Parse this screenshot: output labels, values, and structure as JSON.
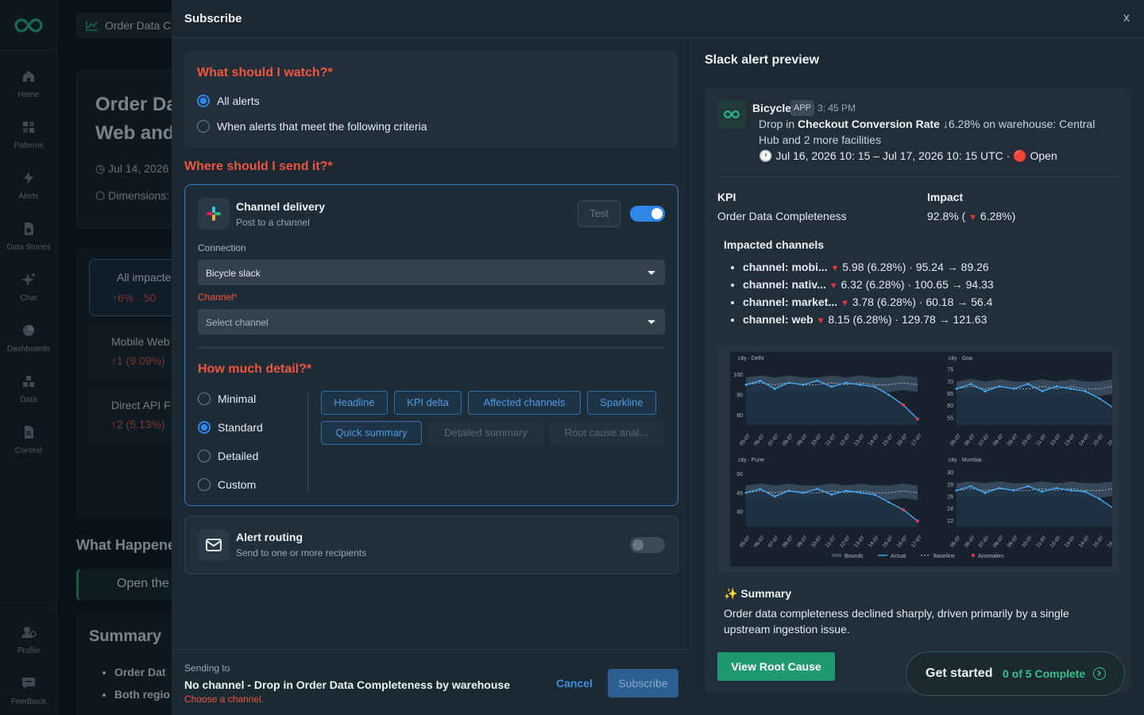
{
  "rail": {
    "items": [
      {
        "label": "Home",
        "icon": "home-icon"
      },
      {
        "label": "Patterns",
        "icon": "patterns-icon"
      },
      {
        "label": "Alerts",
        "icon": "alerts-icon"
      },
      {
        "label": "Data Stories",
        "icon": "data-stories-icon"
      },
      {
        "label": "Chat",
        "icon": "chat-icon"
      },
      {
        "label": "Dashboards",
        "icon": "dashboards-icon"
      },
      {
        "label": "Data",
        "icon": "data-icon"
      },
      {
        "label": "Context",
        "icon": "context-icon"
      }
    ],
    "bottom": [
      {
        "label": "Profile",
        "icon": "profile-icon"
      },
      {
        "label": "Feedback",
        "icon": "feedback-icon"
      }
    ]
  },
  "background": {
    "tab_label": "Order Data C",
    "title_line1": "Order Da",
    "title_line2": "Web and",
    "date": "Jul 14, 2026",
    "dimensions": "Dimensions:",
    "list": [
      {
        "label": "All impacte",
        "metric": "6% · 50"
      },
      {
        "label": "Mobile Web",
        "metric": "1 (9.09%)"
      },
      {
        "label": "Direct API F",
        "metric": "2 (5.13%)"
      }
    ],
    "what_happened": "What Happene",
    "open_label": "Open the",
    "summary_title": "Summary",
    "summary_items": [
      "Order Dat",
      "Both regio"
    ]
  },
  "modal": {
    "title": "Subscribe",
    "close": "x",
    "watch": {
      "title": "What should I watch?*",
      "options": [
        "All alerts",
        "When alerts that meet the following criteria"
      ],
      "selected": 0
    },
    "send": {
      "title": "Where should I send it?*",
      "channel_delivery": {
        "title": "Channel delivery",
        "subtitle": "Post to a channel",
        "test_label": "Test",
        "enabled": true,
        "connection_label": "Connection",
        "connection_value": "Bicycle slack",
        "channel_label": "Channel*",
        "channel_placeholder": "Select channel"
      },
      "detail": {
        "title": "How much detail?*",
        "options": [
          "Minimal",
          "Standard",
          "Detailed",
          "Custom"
        ],
        "selected": 1,
        "chips_active": [
          "Headline",
          "KPI delta",
          "Affected channels",
          "Sparkline",
          "Quick summary"
        ],
        "chips_inactive": [
          "Detailed summary",
          "Root cause anal..."
        ]
      },
      "routing": {
        "title": "Alert routing",
        "subtitle": "Send to one or more recipients",
        "enabled": false
      }
    },
    "footer": {
      "sending_to_label": "Sending to",
      "sending_to_value": "No channel - Drop in Order Data Completeness by warehouse",
      "error": "Choose a channel.",
      "cancel": "Cancel",
      "subscribe": "Subscribe"
    }
  },
  "preview": {
    "title": "Slack alert preview",
    "bot_name": "Bicycle",
    "app_badge": "APP",
    "time": "3: 45 PM",
    "msg_prefix": "Drop in ",
    "msg_kpi": "Checkout Conversion Rate",
    "msg_rest": " ↓6.28% on warehouse: Central Hub and 2 more facilities",
    "msg_line3": "🕐 Jul 16, 2026 10: 15 – Jul 17, 2026 10: 15 UTC · 🔴 Open",
    "kpi_label": "KPI",
    "kpi_value": "Order Data Completeness",
    "impact_label": "Impact",
    "impact_value_a": "92.8% ( ",
    "impact_value_b": " 6.28%)",
    "impacted_title": "Impacted channels",
    "impacted": [
      {
        "name": "channel: mobi...",
        "detail": "5.98 (6.28%) · 95.24 → 89.26"
      },
      {
        "name": "channel: nativ...",
        "detail": "6.32 (6.28%) · 100.65 → 94.33"
      },
      {
        "name": "channel: market...",
        "detail": "3.78 (6.28%) · 60.18 → 56.4"
      },
      {
        "name": "channel: web",
        "detail": "8.15 (6.28%) · 129.78 → 121.63"
      }
    ],
    "summary_title": "✨ Summary",
    "summary_text": "Order data completeness declined sharply, driven primarily by a single upstream ingestion issue.",
    "root_cause_button": "View Root Cause"
  },
  "chart_data": [
    {
      "type": "line",
      "title": "city · Delhi",
      "x": [
        "05-07",
        "06-07",
        "07-07",
        "08-07",
        "09-07",
        "10-07",
        "11-07",
        "12-07",
        "13-07",
        "14-07",
        "15-07",
        "16-07",
        "17-07"
      ],
      "yticks": [
        80,
        90,
        100
      ],
      "ylim": [
        75,
        105
      ],
      "series": [
        {
          "name": "Actual",
          "values": [
            95,
            97,
            93,
            96,
            95,
            97,
            94,
            96,
            95,
            94,
            90,
            85,
            78
          ]
        },
        {
          "name": "Baseline",
          "values": [
            95,
            96,
            95,
            96,
            95,
            95,
            96,
            95,
            96,
            95,
            95,
            96,
            95
          ]
        }
      ]
    },
    {
      "type": "line",
      "title": "city · Goa",
      "x": [
        "05-07",
        "06-07",
        "07-07",
        "08-07",
        "09-07",
        "10-07",
        "11-07",
        "12-07",
        "13-07",
        "14-07",
        "15-07",
        "16-07",
        "17-07"
      ],
      "yticks": [
        55,
        60,
        65,
        70,
        75
      ],
      "ylim": [
        52,
        77
      ],
      "series": [
        {
          "name": "Actual",
          "values": [
            67,
            69,
            66,
            68,
            67,
            69,
            66,
            68,
            67,
            66,
            63,
            59,
            54
          ]
        },
        {
          "name": "Baseline",
          "values": [
            67,
            68,
            67,
            68,
            67,
            67,
            68,
            67,
            68,
            67,
            67,
            68,
            67
          ]
        }
      ]
    },
    {
      "type": "line",
      "title": "city · Pune",
      "x": [
        "05-07",
        "06-07",
        "07-07",
        "08-07",
        "09-07",
        "10-07",
        "11-07",
        "12-07",
        "13-07",
        "14-07",
        "15-07",
        "16-07",
        "17-07"
      ],
      "yticks": [
        40,
        45,
        50
      ],
      "ylim": [
        36,
        52
      ],
      "series": [
        {
          "name": "Actual",
          "values": [
            45,
            46,
            44,
            45.5,
            45,
            46,
            44.5,
            45.5,
            45,
            44.5,
            42.5,
            40.5,
            37.5
          ]
        },
        {
          "name": "Baseline",
          "values": [
            45,
            45.5,
            45,
            45.5,
            45,
            45,
            45.5,
            45,
            45.5,
            45,
            45,
            45.5,
            45
          ]
        }
      ]
    },
    {
      "type": "line",
      "title": "city · Mumbai",
      "x": [
        "05-07",
        "06-07",
        "07-07",
        "08-07",
        "09-07",
        "10-07",
        "11-07",
        "12-07",
        "13-07",
        "14-07",
        "15-07",
        "16-07",
        "17-07"
      ],
      "yticks": [
        22,
        24,
        26,
        28,
        30
      ],
      "ylim": [
        21,
        31
      ],
      "series": [
        {
          "name": "Actual",
          "values": [
            27,
            27.7,
            26.6,
            27.4,
            27,
            27.7,
            26.8,
            27.4,
            27,
            26.8,
            25.6,
            24,
            22.2
          ]
        },
        {
          "name": "Baseline",
          "values": [
            27,
            27.3,
            27,
            27.3,
            27,
            27,
            27.3,
            27,
            27.3,
            27,
            27,
            27.3,
            27
          ]
        }
      ]
    }
  ],
  "chart_legend": [
    "Bounds",
    "Actual",
    "Baseline",
    "Anomalies"
  ],
  "get_started": {
    "label": "Get started",
    "progress": "0 of 5 Complete"
  },
  "colors": {
    "accent": "#2f87e8",
    "error": "#f0553e",
    "success": "#1f9a70",
    "actual": "#4aa8f0",
    "anomaly": "#e8335a"
  }
}
